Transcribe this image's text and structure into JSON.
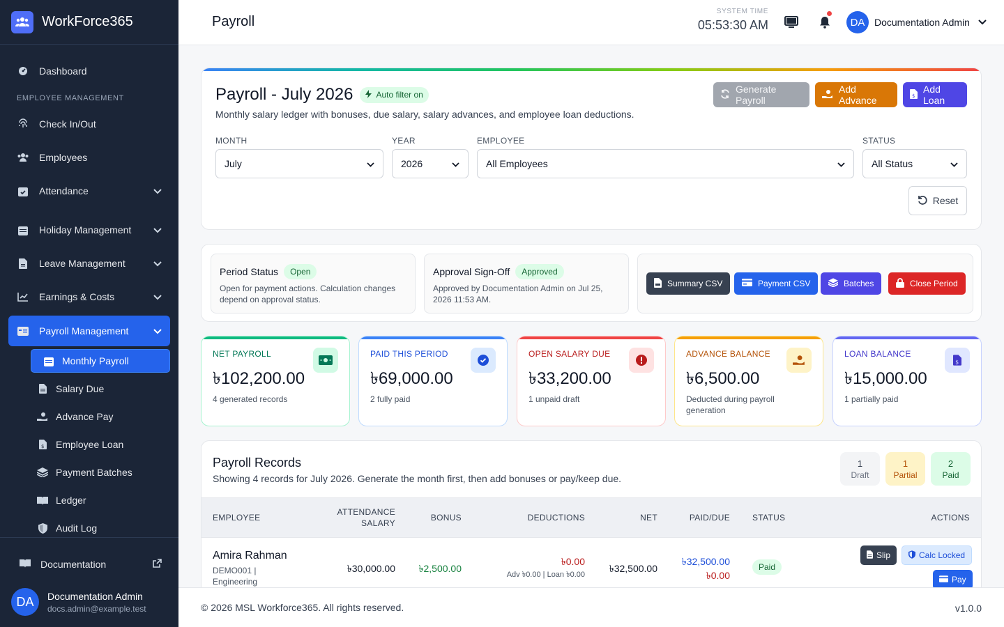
{
  "brand": {
    "name": "WorkForce365"
  },
  "sidebar": {
    "dashboard": "Dashboard",
    "section": "EMPLOYEE MANAGEMENT",
    "items": [
      "Check In/Out",
      "Employees",
      "Attendance",
      "Holiday Management",
      "Leave Management",
      "Earnings & Costs",
      "Payroll Management"
    ],
    "subitems": [
      "Monthly Payroll",
      "Salary Due",
      "Advance Pay",
      "Employee Loan",
      "Payment Batches",
      "Ledger",
      "Audit Log"
    ],
    "documentation": "Documentation",
    "user": {
      "initials": "DA",
      "name": "Documentation Admin",
      "email": "docs.admin@example.test"
    }
  },
  "header": {
    "title": "Payroll",
    "system_time_label": "SYSTEM TIME",
    "system_time": "05:53:30 AM",
    "user_initials": "DA",
    "user_name": "Documentation Admin"
  },
  "filter": {
    "title": "Payroll - July 2026",
    "auto_filter": "Auto filter on",
    "subtitle": "Monthly salary ledger with bonuses, due salary, salary advances, and employee loan deductions.",
    "buttons": {
      "generate": "Generate Payroll",
      "advance": "Add Advance",
      "loan": "Add Loan"
    },
    "labels": {
      "month": "MONTH",
      "year": "YEAR",
      "employee": "EMPLOYEE",
      "status": "STATUS"
    },
    "values": {
      "month": "July",
      "year": "2026",
      "employee": "All Employees",
      "status": "All Status"
    },
    "reset": "Reset"
  },
  "period": {
    "status_title": "Period Status",
    "status_badge": "Open",
    "status_text": "Open for payment actions. Calculation changes depend on approval status.",
    "approval_title": "Approval Sign-Off",
    "approval_badge": "Approved",
    "approval_text": "Approved by Documentation Admin on Jul 25, 2026 11:53 AM.",
    "buttons": {
      "summary": "Summary CSV",
      "payment": "Payment CSV",
      "batches": "Batches",
      "close": "Close Period"
    }
  },
  "kpis": [
    {
      "label": "NET PAYROLL",
      "value": "৳102,200.00",
      "note": "4 generated records",
      "color": "#10b981",
      "icon": "money-icon"
    },
    {
      "label": "PAID THIS PERIOD",
      "value": "৳69,000.00",
      "note": "2 fully paid",
      "color": "#3b82f6",
      "icon": "check-circle-icon"
    },
    {
      "label": "OPEN SALARY DUE",
      "value": "৳33,200.00",
      "note": "1 unpaid draft",
      "color": "#ef4444",
      "icon": "alert-icon"
    },
    {
      "label": "ADVANCE BALANCE",
      "value": "৳6,500.00",
      "note": "Deducted during payroll generation",
      "color": "#f59e0b",
      "icon": "hand-coin-icon"
    },
    {
      "label": "LOAN BALANCE",
      "value": "৳15,000.00",
      "note": "1 partially paid",
      "color": "#6366f1",
      "icon": "invoice-icon"
    }
  ],
  "records": {
    "title": "Payroll Records",
    "subtitle": "Showing 4 records for July 2026. Generate the month first, then add bonuses or pay/keep due.",
    "counts": [
      {
        "n": "1",
        "label": "Draft"
      },
      {
        "n": "1",
        "label": "Partial"
      },
      {
        "n": "2",
        "label": "Paid"
      }
    ],
    "columns": [
      "EMPLOYEE",
      "ATTENDANCE SALARY",
      "BONUS",
      "DEDUCTIONS",
      "NET",
      "PAID/DUE",
      "STATUS",
      "ACTIONS"
    ],
    "rows": [
      {
        "name": "Amira Rahman",
        "meta": "DEMO001 | Engineering",
        "attendance": "৳30,000.00",
        "bonus": "৳2,500.00",
        "deductions": "৳0.00",
        "deduction_detail": "Adv ৳0.00 | Loan ৳0.00",
        "net": "৳32,500.00",
        "paid": "৳32,500.00",
        "due": "৳0.00",
        "status": "Paid",
        "actions": {
          "slip": "Slip",
          "locked": "Calc Locked",
          "pay": "Pay"
        }
      }
    ]
  },
  "footer": {
    "copyright": "© 2026 MSL Workforce365. All rights reserved.",
    "version": "v1.0.0"
  }
}
